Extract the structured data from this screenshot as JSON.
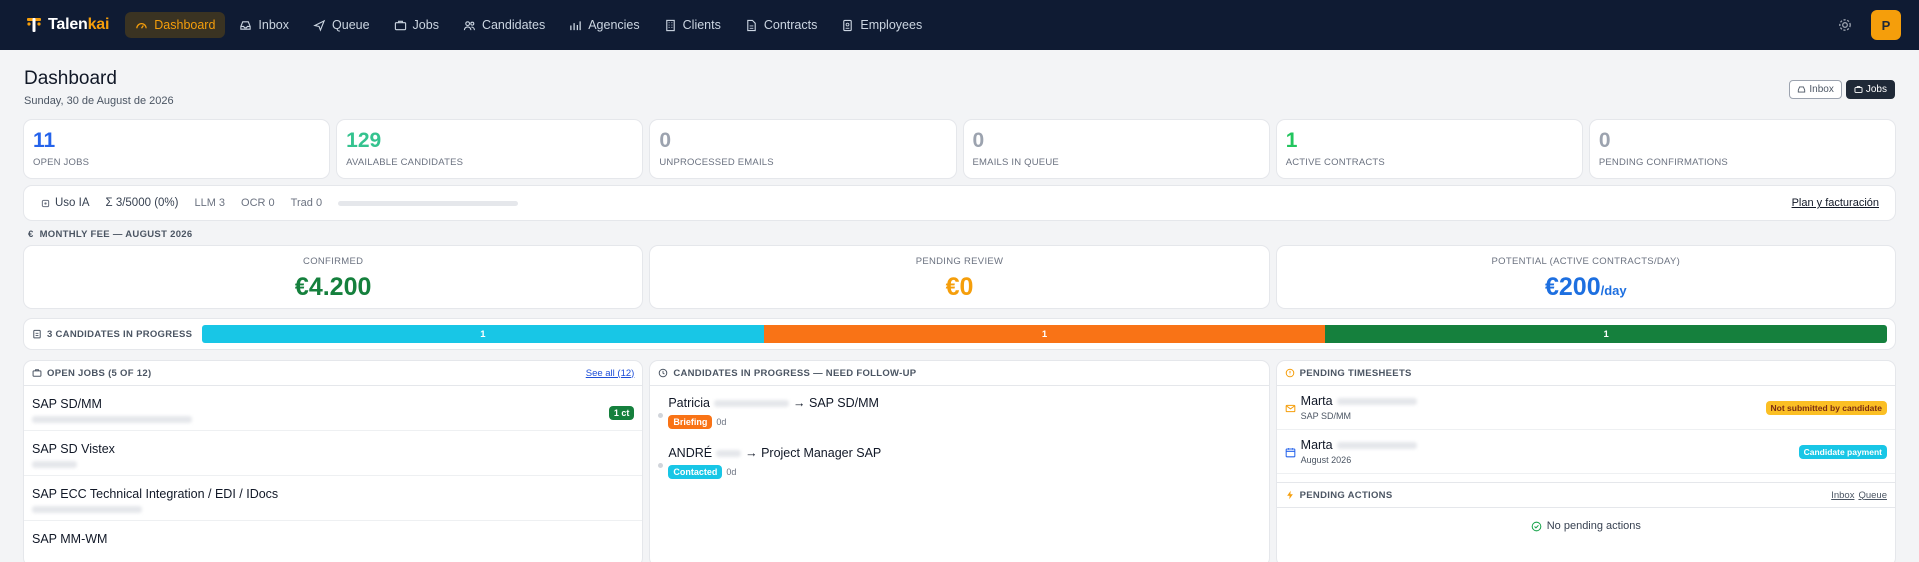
{
  "brand": {
    "name_main": "Talen",
    "name_accent": "kai",
    "accent_color": "#f59e0b",
    "nav_bg": "#0f1b33"
  },
  "nav": {
    "items": [
      {
        "label": "Dashboard",
        "icon": "gauge-icon",
        "active": true
      },
      {
        "label": "Inbox",
        "icon": "inbox-icon"
      },
      {
        "label": "Queue",
        "icon": "send-icon"
      },
      {
        "label": "Jobs",
        "icon": "briefcase-icon"
      },
      {
        "label": "Candidates",
        "icon": "users-icon"
      },
      {
        "label": "Agencies",
        "icon": "chart-icon"
      },
      {
        "label": "Clients",
        "icon": "building-icon"
      },
      {
        "label": "Contracts",
        "icon": "file-icon"
      },
      {
        "label": "Employees",
        "icon": "badge-icon"
      }
    ],
    "avatar_initial": "P"
  },
  "header": {
    "title": "Dashboard",
    "date": "Sunday, 30 de August de 2026",
    "btn_inbox": "Inbox",
    "btn_jobs": "Jobs"
  },
  "stats": [
    {
      "value": "11",
      "label": "OPEN JOBS",
      "color": "#2563eb"
    },
    {
      "value": "129",
      "label": "AVAILABLE CANDIDATES",
      "color": "#34c38f"
    },
    {
      "value": "0",
      "label": "UNPROCESSED EMAILS",
      "color": "#9ca3af"
    },
    {
      "value": "0",
      "label": "EMAILS IN QUEUE",
      "color": "#9ca3af"
    },
    {
      "value": "1",
      "label": "ACTIVE CONTRACTS",
      "color": "#22c55e"
    },
    {
      "value": "0",
      "label": "PENDING CONFIRMATIONS",
      "color": "#9ca3af"
    }
  ],
  "usage": {
    "title": "Uso IA",
    "total": "Σ 3/5000 (0%)",
    "llm": "LLM 3",
    "ocr": "OCR 0",
    "trad": "Trad 0",
    "progress": 0.0,
    "link": "Plan y facturación"
  },
  "monthly_fee": {
    "title": "MONTHLY FEE — AUGUST 2026",
    "confirmed": {
      "label": "CONFIRMED",
      "value": "€4.200",
      "color": "#15803d"
    },
    "pending": {
      "label": "PENDING REVIEW",
      "value": "€0",
      "color": "#f59e0b"
    },
    "potential": {
      "label": "POTENTIAL (ACTIVE CONTRACTS/DAY)",
      "value": "€200",
      "unit": "/day",
      "color": "#1d6fe0"
    }
  },
  "progress": {
    "label": "3 CANDIDATES IN PROGRESS",
    "segments": [
      {
        "value": "1",
        "color": "#18c6e6"
      },
      {
        "value": "1",
        "color": "#f97316"
      },
      {
        "value": "1",
        "color": "#15803d"
      }
    ]
  },
  "open_jobs": {
    "title": "OPEN JOBS (5 OF 12)",
    "see_all": "See all (12)",
    "items": [
      {
        "title": "SAP SD/MM",
        "badge": "1 ct"
      },
      {
        "title": "SAP SD Vistex"
      },
      {
        "title": "SAP ECC Technical Integration / EDI / IDocs"
      },
      {
        "title": "SAP MM-WM"
      }
    ]
  },
  "candidates": {
    "title": "CANDIDATES IN PROGRESS — NEED FOLLOW-UP",
    "items": [
      {
        "name": "Patricia",
        "job": "→ SAP SD/MM",
        "status": "Briefing",
        "status_color": "#f97316",
        "days": "0d"
      },
      {
        "name": "ANDRÉ",
        "job": "→ Project Manager SAP",
        "status": "Contacted",
        "status_color": "#18c6e6",
        "days": "0d"
      }
    ]
  },
  "timesheets": {
    "title": "PENDING TIMESHEETS",
    "items": [
      {
        "name": "Marta",
        "sub": "SAP SD/MM",
        "icon": "mail-icon",
        "badge": "Not submitted by candidate",
        "badge_bg": "#fbbf24",
        "badge_fg": "#7c2d12"
      },
      {
        "name": "Marta",
        "sub": "August 2026",
        "icon": "calendar-icon",
        "badge": "Candidate payment",
        "badge_bg": "#18c6e6",
        "badge_fg": "#ffffff"
      }
    ]
  },
  "pending_actions": {
    "title": "PENDING ACTIONS",
    "link_inbox": "Inbox",
    "link_queue": "Queue",
    "empty": "No pending actions"
  }
}
